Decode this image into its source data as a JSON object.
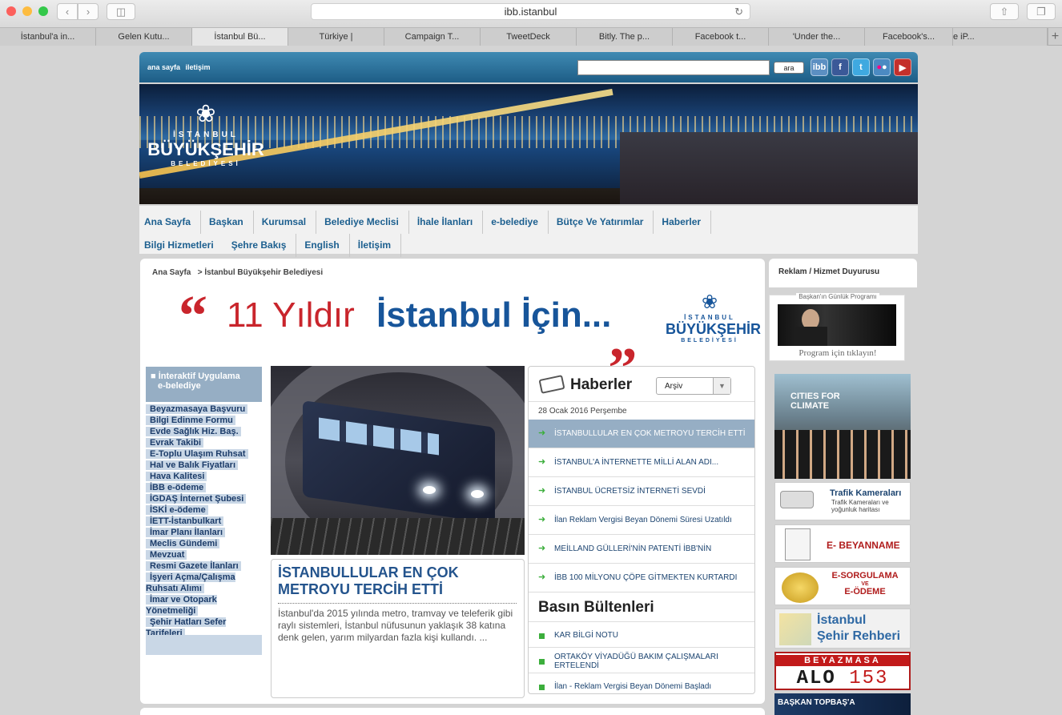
{
  "browser": {
    "url": "ibb.istanbul",
    "tabs": [
      "İstanbul'a in...",
      "Gelen Kutu...",
      "İstanbul Bü...",
      "Türkiye |",
      "Campaign T...",
      "TweetDeck",
      "Bitly. The p...",
      "Facebook t...",
      "'Under the...",
      "Facebook's...",
      "e iP..."
    ],
    "active_tab": 2,
    "colors": {
      "close": "#fc605c",
      "minimize": "#fdbc40",
      "zoom": "#34c84a"
    }
  },
  "topbar": {
    "links": [
      "ana sayfa",
      "iletişim"
    ],
    "search_button": "ara",
    "social_icons": [
      "ibb-icon",
      "facebook-icon",
      "twitter-icon",
      "flickr-icon",
      "youtube-icon"
    ]
  },
  "logo": {
    "line1": "İSTANBUL",
    "line2": "BÜYÜKŞEHİR",
    "line3": "BELEDİYESİ"
  },
  "menu": [
    "Ana Sayfa",
    "Başkan",
    "Kurumsal",
    "Belediye Meclisi",
    "İhale İlanları",
    "e-belediye",
    "Bütçe Ve Yatırımlar",
    "Haberler",
    "Bilgi Hizmetleri",
    "Şehre Bakış",
    "English",
    "İletişim"
  ],
  "breadcrumb": {
    "home": "Ana Sayfa",
    "current": "> İstanbul Büyükşehir Belediyesi"
  },
  "slogan": {
    "open_quote": "“",
    "part1": "11 Yıldır",
    "part2": "İstanbul İçin...",
    "close_quote": "„"
  },
  "eservices": {
    "header_line1": "İnteraktif Uygulama",
    "header_line2": "e-belediye",
    "items": [
      "Beyazmasaya Başvuru",
      "Bilgi Edinme Formu",
      "Evde Sağlık Hiz. Baş.",
      "Evrak Takibi",
      "E-Toplu Ulaşım Ruhsat",
      "Hal ve Balık Fiyatları",
      "Hava Kalitesi",
      "İBB e-ödeme",
      "İGDAŞ İnternet Şubesi",
      "İSKİ e-ödeme",
      "İETT-İstanbulkart",
      "İmar Planı İlanları",
      "Meclis Gündemi",
      "Mevzuat",
      "Resmi Gazete İlanları",
      "İşyeri Açma/Çalışma Ruhsatı Alımı",
      "İmar ve Otopark Yönetmeliği",
      "Şehir Hatları Sefer Tarifeleri"
    ]
  },
  "feature": {
    "title": "İSTANBULLULAR EN ÇOK METROYU TERCİH ETTİ",
    "text": "İstanbul'da 2015 yılında metro, tramvay ve teleferik gibi raylı sistemleri, İstanbul nüfusunun yaklaşık 38 katına denk gelen, yarım milyardan fazla kişi kullandı. ..."
  },
  "news": {
    "title": "Haberler",
    "archive_select": "Arşiv",
    "date": "28 Ocak 2016 Perşembe",
    "items": [
      "İSTANBULLULAR EN ÇOK METROYU TERCİH ETTİ",
      "İSTANBUL'A İNTERNETTE MİLLİ ALAN ADI...",
      "İSTANBUL ÜCRETSİZ İNTERNETİ SEVDİ",
      "İlan Reklam Vergisi Beyan Dönemi Süresi Uzatıldı",
      "MEİLLAND GÜLLERİ'NİN PATENTİ İBB'NİN",
      "İBB 100 MİLYONU ÇÖPE GİTMEKTEN KURTARDI"
    ],
    "selected": 0
  },
  "bulletins": {
    "title": "Basın Bültenleri",
    "items": [
      "KAR BİLGİ NOTU",
      "ORTAKÖY VİYADÜĞÜ BAKIM ÇALIŞMALARI ERTELENDİ",
      "İlan - Reklam Vergisi Beyan Dönemi Başladı"
    ]
  },
  "right": {
    "header": "Reklam / Hizmet Duyurusu",
    "baskan_title": "Başkan'ın Günlük Programı",
    "baskan_caption": "Program için tıklayın!",
    "climate": "CITIES FOR CLIMATE",
    "traffic_title": "Trafik Kameraları",
    "traffic_sub": "Trafik Kameraları ve yoğunluk haritası",
    "ebeyanname": "E- BEYANNAME",
    "esorgulama": "E-SORGULAMA",
    "ve": "VE",
    "eodeme": "E-ÖDEME",
    "rehber1": "İstanbul",
    "rehber2": "Şehir Rehberi",
    "beyazmasa": "BEYAZMASA",
    "alo": "ALO",
    "alo_num": "153",
    "topbas": "BAŞKAN TOPBAŞ'A"
  }
}
